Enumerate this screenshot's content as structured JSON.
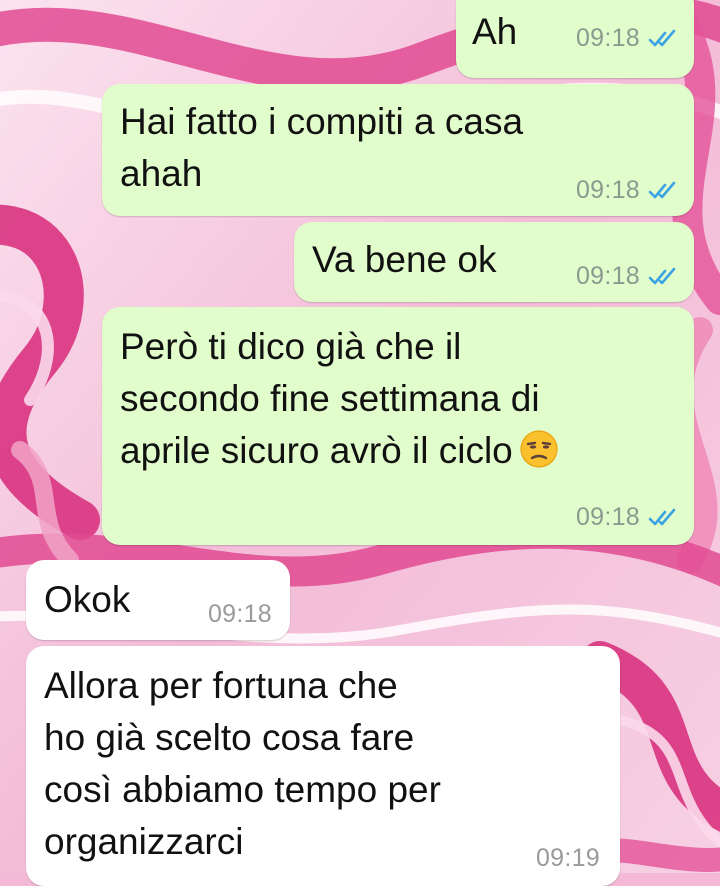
{
  "colors": {
    "outgoing_bubble": "#e2fdcc",
    "incoming_bubble": "#ffffff",
    "read_ticks": "#3aa3e3",
    "wallpaper_pink": "#e0488f",
    "wallpaper_light": "#f9dcea"
  },
  "messages": [
    {
      "direction": "outgoing",
      "text": "Ah",
      "time": "09:18",
      "status": "read"
    },
    {
      "direction": "outgoing",
      "text": "Hai fatto i compiti a casa\nahah",
      "time": "09:18",
      "status": "read"
    },
    {
      "direction": "outgoing",
      "text": "Va bene ok",
      "time": "09:18",
      "status": "read"
    },
    {
      "direction": "outgoing",
      "text": "Però ti dico già che il\nsecondo fine settimana di\naprile sicuro avrò il ciclo",
      "emoji": "unamused-face-icon",
      "time": "09:18",
      "status": "read"
    },
    {
      "direction": "incoming",
      "text": "Okok",
      "time": "09:18"
    },
    {
      "direction": "incoming",
      "text": "Allora per fortuna che\nho già scelto cosa fare\ncosì abbiamo tempo per\norganizzarci",
      "time": "09:19"
    }
  ]
}
